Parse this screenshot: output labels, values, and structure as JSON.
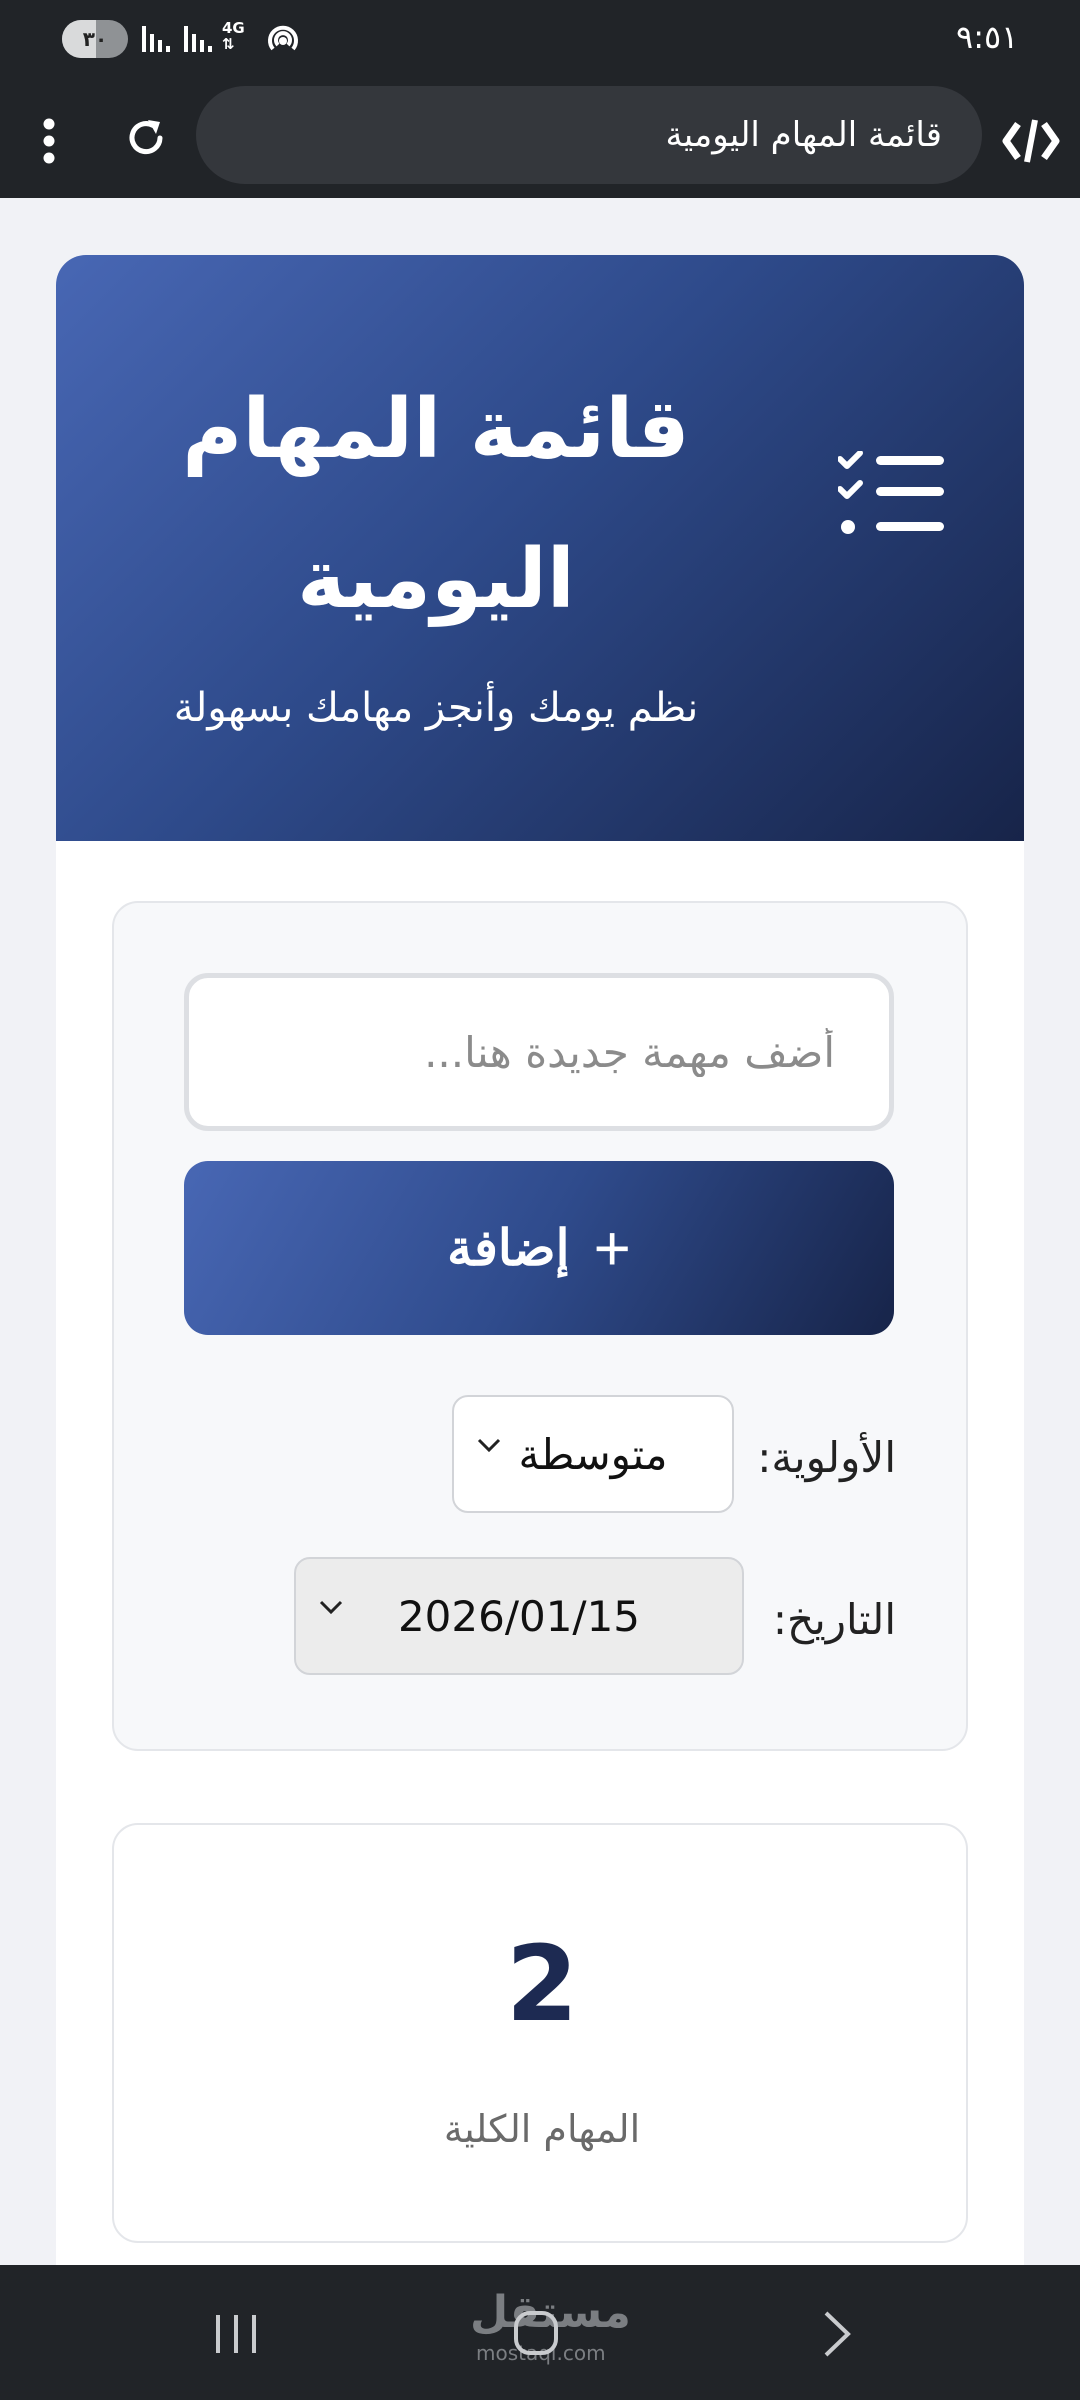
{
  "status": {
    "time": "٩:٥١",
    "battery": "٣٠",
    "network": "4G"
  },
  "browser": {
    "url_title": "قائمة المهام اليومية"
  },
  "hero": {
    "title": "قائمة المهام اليومية",
    "subtitle": "نظم يومك وأنجز مهامك بسهولة",
    "icon": "checklist-icon"
  },
  "form": {
    "task_placeholder": "أضف مهمة جديدة هنا...",
    "add_label": "إضافة",
    "priority_label": "الأولوية:",
    "priority_value": "متوسطة",
    "date_label": "التاريخ:",
    "date_value": "2026/01/15"
  },
  "stats": {
    "total_value": "2",
    "total_label": "المهام الكلية"
  },
  "navbar": {
    "watermark": "مستقل",
    "watermark_sub": "mostaql.com"
  },
  "colors": {
    "accent_start": "#4867b4",
    "accent_end": "#172449",
    "bar_bg": "#212428"
  }
}
